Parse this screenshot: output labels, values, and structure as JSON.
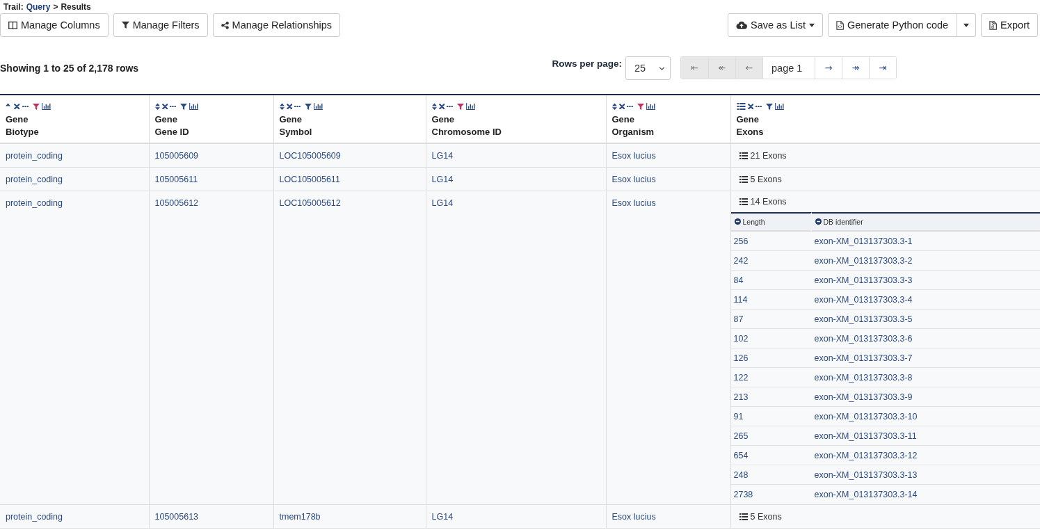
{
  "breadcrumb": {
    "label": "Trail:",
    "separator": ">",
    "items": [
      {
        "text": "Query",
        "kind": "link"
      },
      {
        "text": "Results",
        "kind": "current"
      }
    ]
  },
  "toolbar": {
    "left": [
      {
        "label": "Manage Columns",
        "kind": "columns"
      },
      {
        "label": "Manage Filters",
        "kind": "filters"
      },
      {
        "label": "Manage Relationships",
        "kind": "relationships"
      }
    ],
    "right": [
      {
        "label": "Save as List",
        "kind": "save",
        "dropdown": true,
        "split": false
      },
      {
        "label": "Generate Python code",
        "kind": "code",
        "dropdown": true,
        "split": true
      },
      {
        "label": "Export",
        "kind": "export",
        "dropdown": false,
        "split": false
      }
    ]
  },
  "summary": "Showing 1 to 25 of 2,178 rows",
  "rows_per_page": {
    "label": "Rows per page:",
    "value": "25"
  },
  "pagination": [
    {
      "kind": "button",
      "symbol": "⇤",
      "disabled": true
    },
    {
      "kind": "button",
      "symbol": "↞",
      "disabled": true
    },
    {
      "kind": "button",
      "symbol": "←",
      "disabled": true
    },
    {
      "kind": "field",
      "value": "page 1"
    },
    {
      "kind": "button",
      "symbol": "→",
      "disabled": false
    },
    {
      "kind": "button",
      "symbol": "↠",
      "disabled": false
    },
    {
      "kind": "button",
      "symbol": "⇥",
      "disabled": false
    }
  ],
  "table": {
    "columns": [
      {
        "group": "Gene",
        "name": "Biotype",
        "kind": "attribute",
        "sorted": true,
        "filtered": true
      },
      {
        "group": "Gene",
        "name": "Gene ID",
        "kind": "attribute",
        "sorted": false,
        "filtered": false
      },
      {
        "group": "Gene",
        "name": "Symbol",
        "kind": "attribute",
        "sorted": false,
        "filtered": false
      },
      {
        "group": "Gene",
        "name": "Chromosome ID",
        "kind": "attribute",
        "sorted": false,
        "filtered": true
      },
      {
        "group": "Gene",
        "name": "Organism",
        "kind": "attribute",
        "sorted": false,
        "filtered": true
      },
      {
        "group": "Gene",
        "name": "Exons",
        "kind": "collection",
        "filtered": false
      }
    ],
    "rows": [
      {
        "cells": [
          "protein_coding",
          "105005609",
          "LOC105005609",
          "LG14",
          "Esox lucius"
        ],
        "exons": {
          "label": "21 Exons",
          "expanded": false
        }
      },
      {
        "cells": [
          "protein_coding",
          "105005611",
          "LOC105005611",
          "LG14",
          "Esox lucius"
        ],
        "exons": {
          "label": "5 Exons",
          "expanded": false
        }
      },
      {
        "cells": [
          "protein_coding",
          "105005612",
          "LOC105005612",
          "LG14",
          "Esox lucius"
        ],
        "exons": {
          "label": "14 Exons",
          "expanded": true,
          "subtable": {
            "columns": [
              "Length",
              "DB identifier"
            ],
            "rows": [
              [
                "256",
                "exon-XM_013137303.3-1"
              ],
              [
                "242",
                "exon-XM_013137303.3-2"
              ],
              [
                "84",
                "exon-XM_013137303.3-3"
              ],
              [
                "114",
                "exon-XM_013137303.3-4"
              ],
              [
                "87",
                "exon-XM_013137303.3-5"
              ],
              [
                "102",
                "exon-XM_013137303.3-6"
              ],
              [
                "126",
                "exon-XM_013137303.3-7"
              ],
              [
                "122",
                "exon-XM_013137303.3-8"
              ],
              [
                "213",
                "exon-XM_013137303.3-9"
              ],
              [
                "91",
                "exon-XM_013137303.3-10"
              ],
              [
                "265",
                "exon-XM_013137303.3-11"
              ],
              [
                "654",
                "exon-XM_013137303.3-12"
              ],
              [
                "248",
                "exon-XM_013137303.3-13"
              ],
              [
                "2738",
                "exon-XM_013137303.3-14"
              ]
            ]
          }
        }
      },
      {
        "cells": [
          "protein_coding",
          "105005613",
          "tmem178b",
          "LG14",
          "Esox lucius"
        ],
        "exons": {
          "label": "5 Exons",
          "expanded": false
        }
      }
    ]
  }
}
